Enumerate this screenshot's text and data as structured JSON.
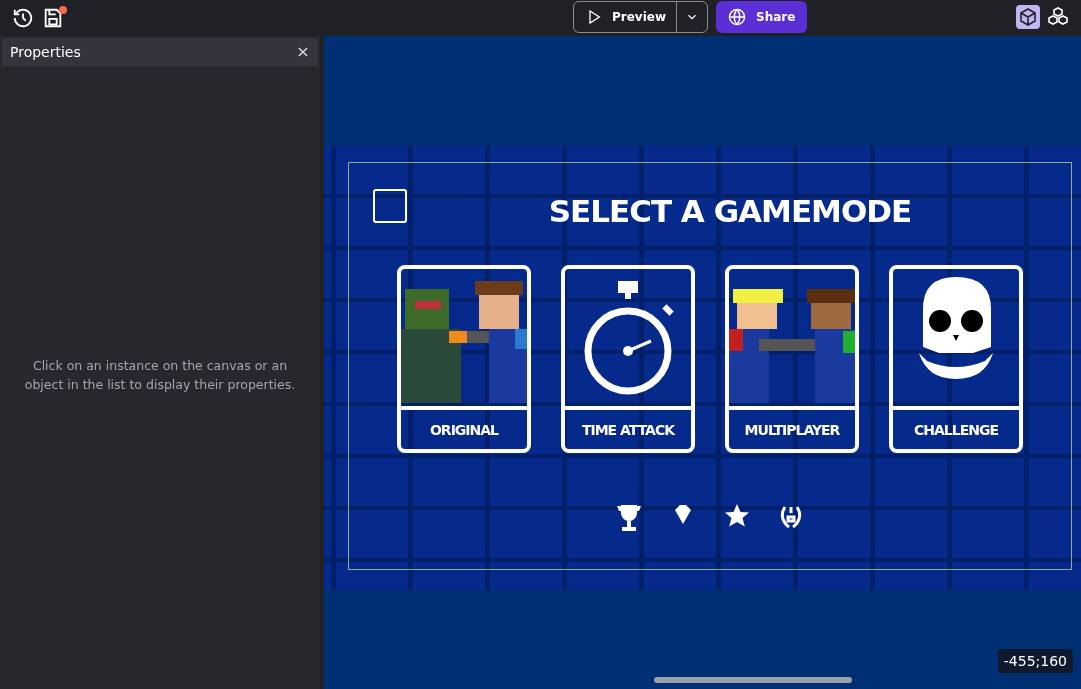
{
  "toolbar": {
    "preview": "Preview",
    "share": "Share",
    "unsaved": true
  },
  "properties_panel": {
    "title": "Properties",
    "message": "Click on an instance on the canvas or an object in the list to display their properties."
  },
  "game": {
    "title": "SELECT A GAMEMODE",
    "modes": [
      {
        "label": "ORIGINAL",
        "kind": "zombie"
      },
      {
        "label": "TIME ATTACK",
        "kind": "stopwatch"
      },
      {
        "label": "MULTIPLAYER",
        "kind": "duo"
      },
      {
        "label": "CHALLENGE",
        "kind": "skull"
      }
    ]
  },
  "coordinates": "-455;160"
}
